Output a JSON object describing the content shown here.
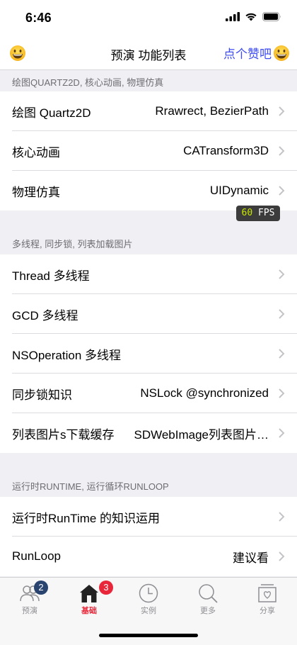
{
  "status": {
    "time": "6:46"
  },
  "nav": {
    "title": "预演 功能列表",
    "right_label": "点个赞吧",
    "left_icon": "grinning-face-icon",
    "right_icon": "grinning-face-icon"
  },
  "sections": [
    {
      "header": "绘图QUARTZ2D, 核心动画, 物理仿真",
      "rows": [
        {
          "title": "绘图 Quartz2D",
          "detail": "Rrawrect, BezierPath"
        },
        {
          "title": "核心动画",
          "detail": "CATransform3D"
        },
        {
          "title": "物理仿真",
          "detail": "UIDynamic"
        }
      ]
    },
    {
      "header": "多线程, 同步锁, 列表加载图片",
      "rows": [
        {
          "title": "Thread 多线程",
          "detail": ""
        },
        {
          "title": "GCD 多线程",
          "detail": ""
        },
        {
          "title": "NSOperation 多线程",
          "detail": ""
        },
        {
          "title": "同步锁知识",
          "detail": "NSLock @synchronized"
        },
        {
          "title": "列表图片s下载缓存",
          "detail": "SDWebImage列表图片…"
        }
      ]
    },
    {
      "header": "运行时RUNTIME, 运行循环RUNLOOP",
      "rows": [
        {
          "title": "运行时RunTime 的知识运用",
          "detail": ""
        },
        {
          "title": "RunLoop",
          "detail": "建议看"
        }
      ]
    }
  ],
  "fps": {
    "value": "60",
    "unit": "FPS"
  },
  "tabs": [
    {
      "label": "预演",
      "icon": "people-icon",
      "badge": "2",
      "active": false
    },
    {
      "label": "基础",
      "icon": "home-icon",
      "badge": "3",
      "active": true
    },
    {
      "label": "实例",
      "icon": "clock-icon",
      "badge": "",
      "active": false
    },
    {
      "label": "更多",
      "icon": "search-icon",
      "badge": "",
      "active": false
    },
    {
      "label": "分享",
      "icon": "share-box-icon",
      "badge": "",
      "active": false
    }
  ],
  "colors": {
    "nav_accent": "#3d4bf3",
    "tab_active": "#e8283a",
    "badge_blue": "#2a4470",
    "badge_red": "#e8283a",
    "fps_number": "#c9e600"
  }
}
